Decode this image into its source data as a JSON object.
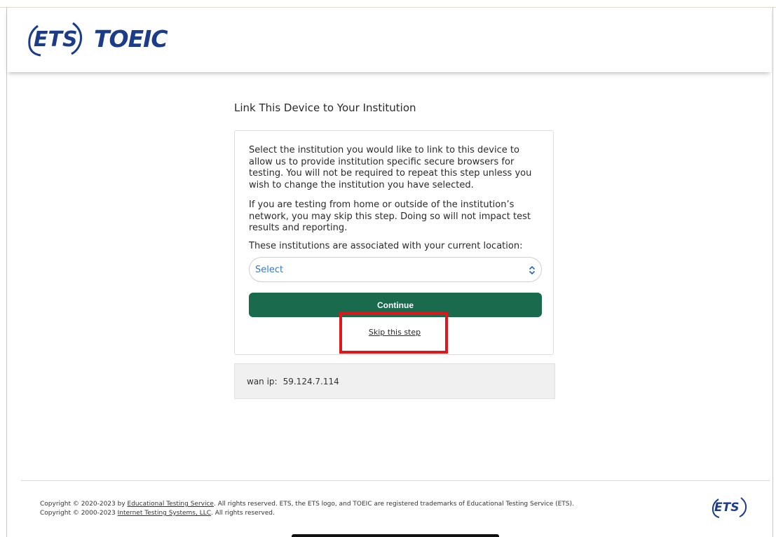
{
  "header": {
    "logo_ets": "ETS",
    "logo_toeic": "TOEIC",
    "registered": "®"
  },
  "main": {
    "title": "Link This Device to Your Institution",
    "paragraph1": "Select the institution you would like to link to this device to allow us to provide institution specific secure browsers for testing. You will not be required to repeat this step unless you wish to change the institution you have selected.",
    "paragraph2": "If you are testing from home or outside of the institution’s network, you may skip this step. Doing so will not impact test results and reporting.",
    "paragraph3": "These institutions are associated with your current location:",
    "select": {
      "value": "Select"
    },
    "continue_label": "Continue",
    "skip_label": "Skip this step"
  },
  "ip": {
    "label": "wan ip:",
    "value": "59.124.7.114"
  },
  "footer": {
    "line1_prefix": "Copyright © 2020-2023 by ",
    "line1_link": "Educational Testing Service",
    "line1_suffix": ". All rights reserved. ETS, the ETS logo, and TOEIC are registered trademarks of Educational Testing Service (ETS).",
    "line2_prefix": "Copyright © 2000-2023 ",
    "line2_link": "Internet Testing Systems, LLC",
    "line2_suffix": ". All rights reserved.",
    "logo": "ETS"
  },
  "colors": {
    "brand_blue": "#1b3c89",
    "continue_green": "#1a6a4e",
    "highlight_red": "#e0161b",
    "select_text": "#3a78c2"
  }
}
